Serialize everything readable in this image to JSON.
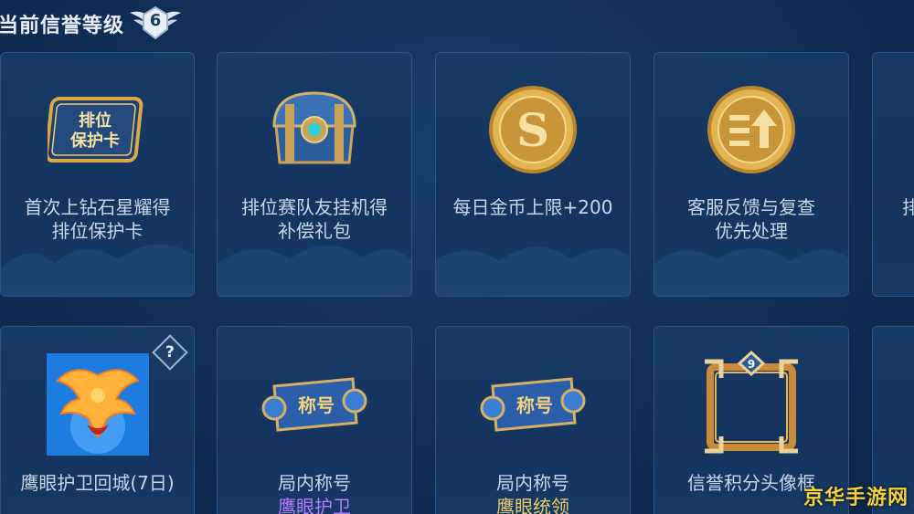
{
  "header": {
    "title": "当前信誉等级",
    "level": "6"
  },
  "cards_row1": [
    {
      "line1": "首次上钻石星耀得",
      "line2": "排位保护卡",
      "icon": "rank-protection-card-icon",
      "icon_text_1": "排位",
      "icon_text_2": "保护卡"
    },
    {
      "line1": "排位赛队友挂机得",
      "line2": "补偿礼包",
      "icon": "treasure-chest-icon"
    },
    {
      "line1": "每日金币上限+200",
      "line2": "",
      "icon": "gold-coin-s-icon"
    },
    {
      "line1": "客服反馈与复查",
      "line2": "优先处理",
      "icon": "priority-coin-icon"
    },
    {
      "line1": "排",
      "line2": "",
      "icon": ""
    }
  ],
  "cards_row2": [
    {
      "line1": "鹰眼护卫回城(7日)",
      "line2": "",
      "icon": "phoenix-recall-icon",
      "help": "?"
    },
    {
      "line1": "局内称号",
      "line2": "鹰眼护卫",
      "icon": "title-scroll-icon",
      "scroll_text": "称号"
    },
    {
      "line1": "局内称号",
      "line2": "鹰眼统领",
      "icon": "title-scroll-icon",
      "scroll_text": "称号"
    },
    {
      "line1": "信誉积分头像框",
      "line2": "",
      "icon": "avatar-frame-icon",
      "frame_badge": "9"
    },
    {
      "line1": "",
      "line2": "",
      "icon": ""
    }
  ],
  "watermark": "京华手游网",
  "colors": {
    "background": "#12305a",
    "card": "#173a66",
    "text": "#c8d6ea",
    "purple": "#b77cff",
    "gold": "#e8cc6a",
    "watermark": "#f4d23a"
  }
}
